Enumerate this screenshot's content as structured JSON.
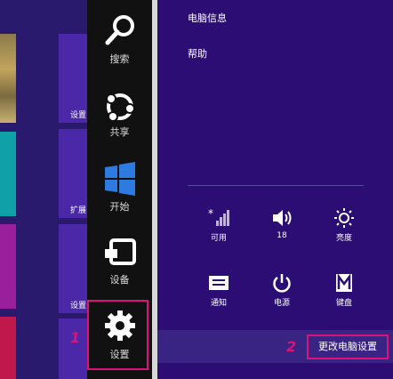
{
  "start_tiles": [
    {
      "label": ""
    },
    {
      "label": "设置"
    },
    {
      "label": "扩展"
    },
    {
      "label": "设置"
    }
  ],
  "charms": [
    {
      "label": "搜索",
      "icon": "search-icon"
    },
    {
      "label": "共享",
      "icon": "share-icon"
    },
    {
      "label": "开始",
      "icon": "windows-icon"
    },
    {
      "label": "设备",
      "icon": "devices-icon"
    },
    {
      "label": "设置",
      "icon": "gear-icon"
    }
  ],
  "settings_pane": {
    "items": [
      {
        "label": "电脑信息"
      },
      {
        "label": "帮助"
      }
    ],
    "quick_settings": [
      {
        "label": "可用",
        "icon": "network-icon"
      },
      {
        "label": "18",
        "icon": "volume-icon"
      },
      {
        "label": "亮度",
        "icon": "brightness-icon"
      },
      {
        "label": "通知",
        "icon": "notifications-icon"
      },
      {
        "label": "电源",
        "icon": "power-icon"
      },
      {
        "label": "键盘",
        "icon": "keyboard-icon"
      }
    ],
    "change_pc_settings": "更改电脑设置"
  },
  "annotations": {
    "step1": "1",
    "step2": "2"
  },
  "colors": {
    "accent": "#d9137a",
    "pane_bg": "#2b0d74",
    "charms_bg": "#111111"
  }
}
